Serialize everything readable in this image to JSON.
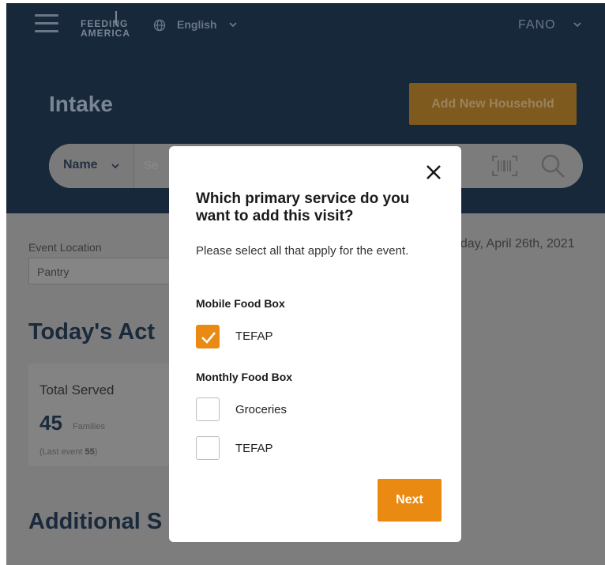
{
  "header": {
    "logo_line1": "FEEDING",
    "logo_line2": "AMERICA",
    "language": "English",
    "user": "FANO"
  },
  "page": {
    "title": "Intake",
    "add_household_label": "Add New Household"
  },
  "search": {
    "filter_label": "Name",
    "placeholder": "Se"
  },
  "event": {
    "label": "Event Location",
    "value": "Pantry",
    "date": "nday, April 26th, 2021"
  },
  "activity": {
    "heading": "Today's Act",
    "total_label": "Total Served",
    "total_value": "45",
    "total_unit": "Families",
    "last_event_prefix": "(Last event ",
    "last_event_value": "55",
    "last_event_suffix": ")"
  },
  "additional": {
    "heading": "Additional S"
  },
  "modal": {
    "title": "Which primary service do you want to add this visit?",
    "subtitle": "Please select all that apply for the event.",
    "sections": [
      {
        "name": "Mobile Food Box",
        "options": [
          {
            "label": "TEFAP",
            "checked": true
          }
        ]
      },
      {
        "name": "Monthly Food Box",
        "options": [
          {
            "label": "Groceries",
            "checked": false
          },
          {
            "label": "TEFAP",
            "checked": false
          }
        ]
      }
    ],
    "next_label": "Next"
  },
  "colors": {
    "header_bg": "#17283b",
    "accent": "#ea8a12",
    "overlay_body": "#7d7d7d"
  }
}
